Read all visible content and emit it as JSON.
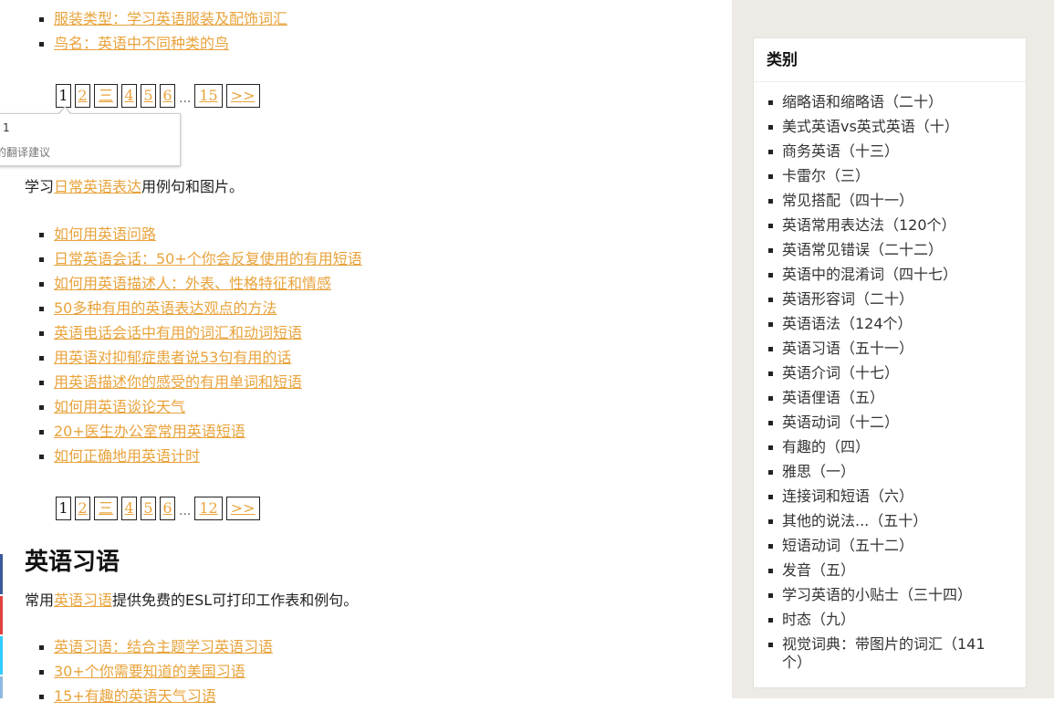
{
  "top_links": [
    "服装类型：学习英语服装及配饰词汇",
    "鸟名：英语中不同种类的鸟"
  ],
  "pager1": {
    "pages": [
      "1",
      "2",
      "三",
      "4",
      "5",
      "6"
    ],
    "ellipsis": "...",
    "last": "15",
    "next": ">>"
  },
  "tooltip": {
    "line1": "1",
    "line2": "好的翻译建议"
  },
  "expressions": {
    "intro_before": "学习",
    "intro_link": "日常英语表达",
    "intro_after": "用例句和图片。",
    "links": [
      "如何用英语问路",
      "日常英语会话：50+个你会反复使用的有用短语",
      "如何用英语描述人：外表、性格特征和情感",
      "50多种有用的英语表达观点的方法",
      "英语电话会话中有用的词汇和动词短语",
      "用英语对抑郁症患者说53句有用的话",
      "用英语描述你的感受的有用单词和短语",
      "如何用英语谈论天气",
      "20+医生办公室常用英语短语",
      "如何正确地用英语计时"
    ]
  },
  "pager2": {
    "pages": [
      "1",
      "2",
      "三",
      "4",
      "5",
      "6"
    ],
    "ellipsis": "...",
    "last": "12",
    "next": ">>"
  },
  "idioms": {
    "heading": "英语习语",
    "intro_before": "常用",
    "intro_link": "英语习语",
    "intro_after": "提供免费的ESL可打印工作表和例句。",
    "links": [
      "英语习语：结合主题学习英语习语",
      "30+个你需要知道的美国习语",
      "15+有趣的英语天气习语"
    ]
  },
  "sidebar": {
    "title": "类别",
    "categories": [
      "缩略语和缩略语（二十）",
      "美式英语vs英式英语（十）",
      "商务英语（十三）",
      "卡雷尔（三）",
      "常见搭配（四十一）",
      "英语常用表达法（120个）",
      "英语常见错误（二十二）",
      "英语中的混淆词（四十七）",
      "英语形容词（二十）",
      "英语语法（124个）",
      "英语习语（五十一）",
      "英语介词（十七）",
      "英语俚语（五）",
      "英语动词（十二）",
      "有趣的（四）",
      "雅思（一）",
      "连接词和短语（六）",
      "其他的说法...（五十）",
      "短语动词（五十二）",
      "发音（五）",
      "学习英语的小贴士（三十四）",
      "时态（九）",
      "视觉词典：带图片的词汇（141个）"
    ]
  },
  "colors": {
    "link": "#e8a33c",
    "sidebar_bg": "#eeebe6",
    "share_facebook": "#3b5998",
    "share_pinterest": "#e0413d",
    "share_twitter": "#33ccff",
    "share_other": "#8fb8e0"
  }
}
